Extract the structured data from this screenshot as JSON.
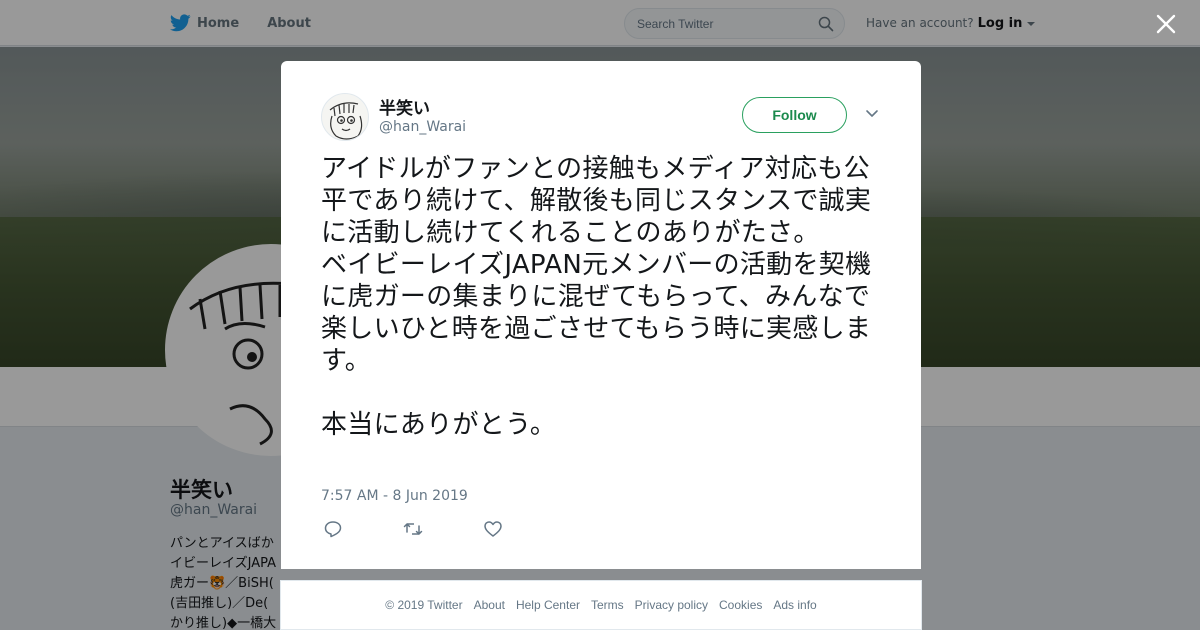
{
  "nav": {
    "home_label": "Home",
    "about_label": "About",
    "search_placeholder": "Search Twitter",
    "account_prompt": "Have an account?",
    "login_label": "Log in"
  },
  "profile": {
    "name": "半笑い",
    "handle": "@han_Warai",
    "bio": "パンとアイスばか\nイビーレイズJAPA\n虎ガー🐯／BiSH(\n(吉田推し)／De(\nかり推し)◆一橋大"
  },
  "tweet": {
    "name": "半笑い",
    "handle": "@han_Warai",
    "follow_label": "Follow",
    "text": "アイドルがファンとの接触もメディア対応も公平であり続けて、解散後も同じスタンスで誠実に活動し続けてくれることのありがたさ。\nベイビーレイズJAPAN元メンバーの活動を契機に虎ガーの集まりに混ぜてもらって、みんなで楽しいひと時を過ごさせてもらう時に実感します。\n\n本当にありがとう。",
    "timestamp": "7:57 AM - 8 Jun 2019"
  },
  "footer": {
    "copyright": "© 2019 Twitter",
    "links": [
      "About",
      "Help Center",
      "Terms",
      "Privacy policy",
      "Cookies",
      "Ads info"
    ]
  },
  "colors": {
    "twitter_blue": "#1da1f2",
    "follow_green": "#1b8a4d",
    "muted_text": "#657786"
  }
}
